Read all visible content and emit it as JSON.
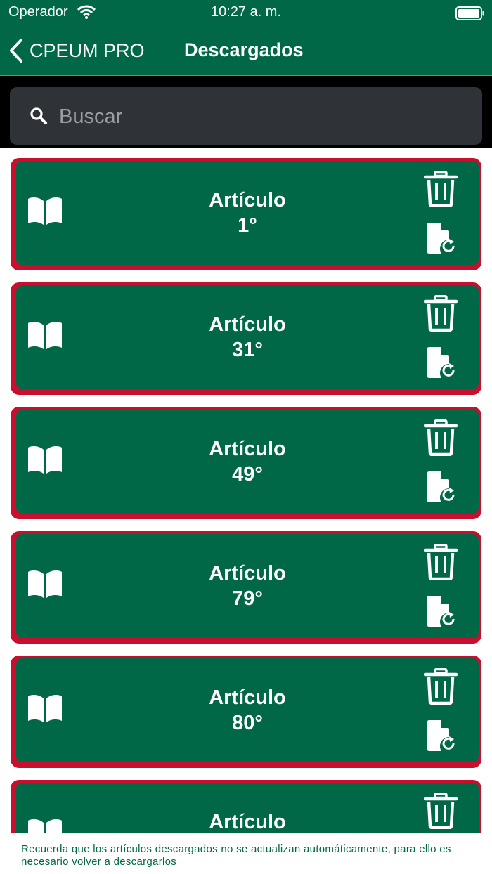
{
  "status_bar": {
    "carrier": "Operador",
    "time": "10:27 a. m."
  },
  "nav": {
    "back_label": "CPEUM PRO",
    "title": "Descargados"
  },
  "search": {
    "placeholder": "Buscar",
    "value": ""
  },
  "articles": [
    {
      "label": "Artículo",
      "number": "1°"
    },
    {
      "label": "Artículo",
      "number": "31°"
    },
    {
      "label": "Artículo",
      "number": "49°"
    },
    {
      "label": "Artículo",
      "number": "79°"
    },
    {
      "label": "Artículo",
      "number": "80°"
    },
    {
      "label": "Artículo",
      "number": ""
    }
  ],
  "icons": {
    "back": "chevron-left-icon",
    "search": "search-icon",
    "article": "book-icon",
    "delete": "trash-icon",
    "update": "file-refresh-icon"
  },
  "footer": {
    "note": "Recuerda que los artículos descargados no se actualizan automáticamente, para ello es necesario volver a descargarlos"
  },
  "colors": {
    "brand_green": "#006847",
    "accent_red": "#c8102e",
    "search_bg": "#2f3236"
  }
}
